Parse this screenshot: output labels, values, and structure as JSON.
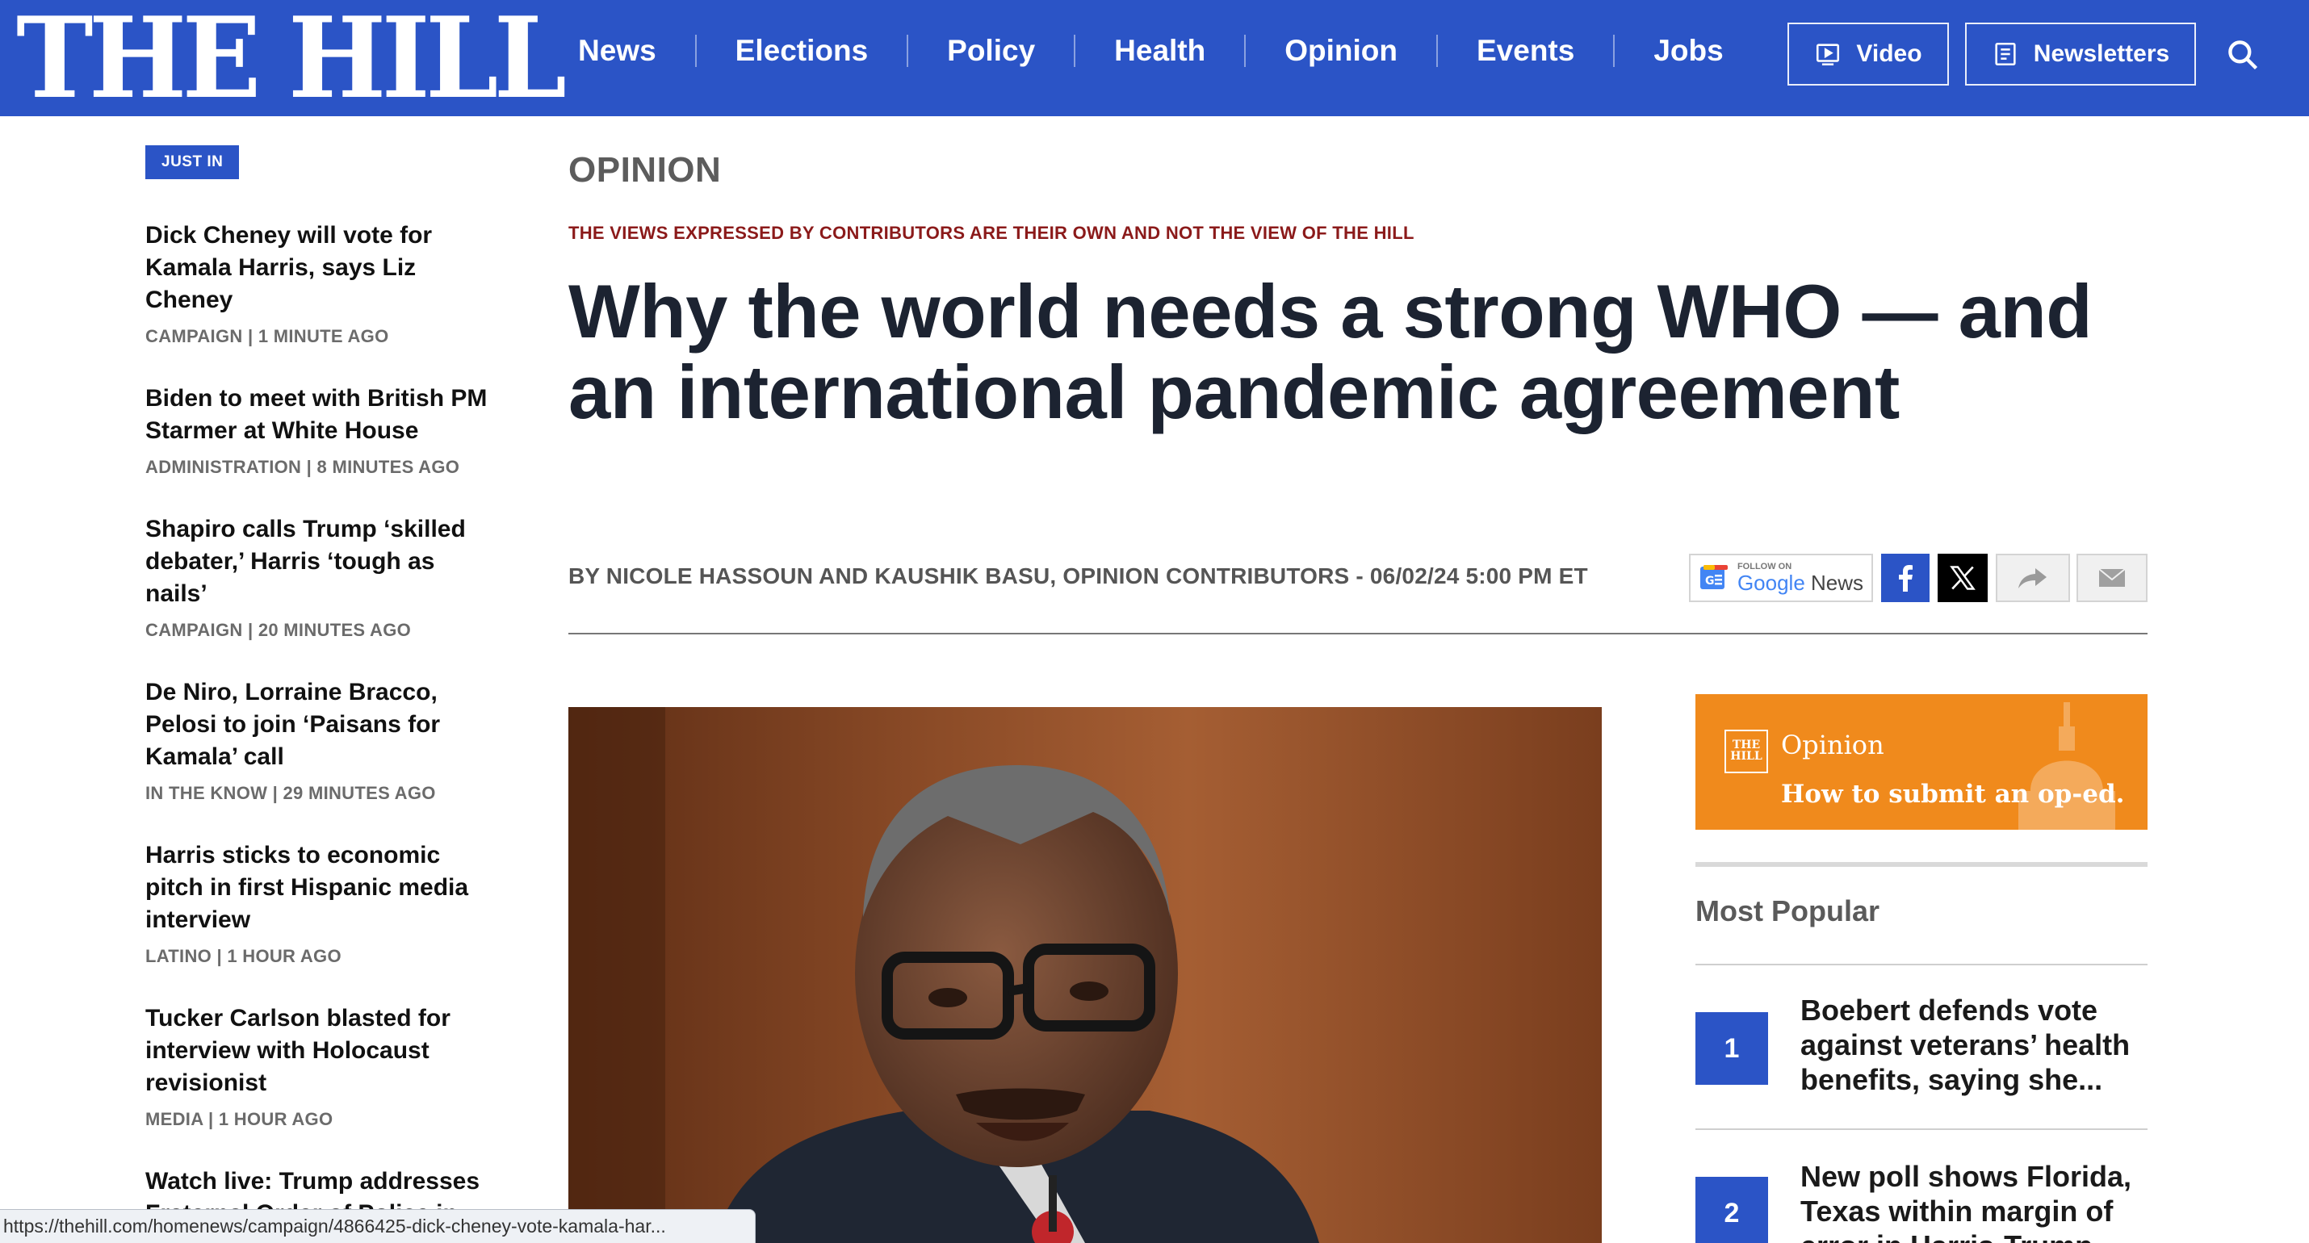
{
  "header": {
    "logo": "THE HILL",
    "nav": [
      "News",
      "Elections",
      "Policy",
      "Health",
      "Opinion",
      "Events",
      "Jobs"
    ],
    "video_label": "Video",
    "newsletters_label": "Newsletters",
    "brand_color": "#2b54c6"
  },
  "rail": {
    "badge": "JUST IN",
    "items": [
      {
        "title": "Dick Cheney will vote for Kamala Harris, says Liz Cheney",
        "meta": "CAMPAIGN | 1 MINUTE AGO"
      },
      {
        "title": "Biden to meet with British PM Starmer at White House",
        "meta": "ADMINISTRATION | 8 MINUTES AGO"
      },
      {
        "title": "Shapiro calls Trump ‘skilled debater,’ Harris ‘tough as nails’",
        "meta": "CAMPAIGN | 20 MINUTES AGO"
      },
      {
        "title": "De Niro, Lorraine Bracco, Pelosi to join ‘Paisans for Kamala’ call",
        "meta": "IN THE KNOW | 29 MINUTES AGO"
      },
      {
        "title": "Harris sticks to economic pitch in first Hispanic media interview",
        "meta": "LATINO | 1 HOUR AGO"
      },
      {
        "title": "Tucker Carlson blasted for interview with Holocaust revisionist",
        "meta": "MEDIA | 1 HOUR AGO"
      },
      {
        "title": "Watch live: Trump addresses Fraternal Order of Police in",
        "meta": ""
      }
    ]
  },
  "article": {
    "section": "OPINION",
    "disclaimer": "THE VIEWS EXPRESSED BY CONTRIBUTORS ARE THEIR OWN AND NOT THE VIEW OF THE HILL",
    "headline": "Why the world needs a strong WHO — and an international pandemic agreement",
    "byline": "BY NICOLE HASSOUN AND KAUSHIK BASU, OPINION CONTRIBUTORS - 06/02/24 5:00 PM ET",
    "share": {
      "gnews_small": "FOLLOW ON",
      "gnews_google": "Google",
      "gnews_news": "News",
      "icons": [
        "facebook-icon",
        "x-icon",
        "share-forward-icon",
        "email-icon"
      ]
    }
  },
  "sidebar": {
    "promo_logo": "THE HILL",
    "promo_label": "Opinion",
    "promo_cta": "How to submit an op-ed.",
    "promo_color": "#f08a1c",
    "popular_heading": "Most Popular",
    "popular": [
      {
        "rank": "1",
        "title": "Boebert defends vote against veterans’ health benefits, saying she..."
      },
      {
        "rank": "2",
        "title": "New poll shows Florida, Texas within margin of error in Harris-Trump"
      }
    ]
  },
  "status_url": "https://thehill.com/homenews/campaign/4866425-dick-cheney-vote-kamala-har..."
}
